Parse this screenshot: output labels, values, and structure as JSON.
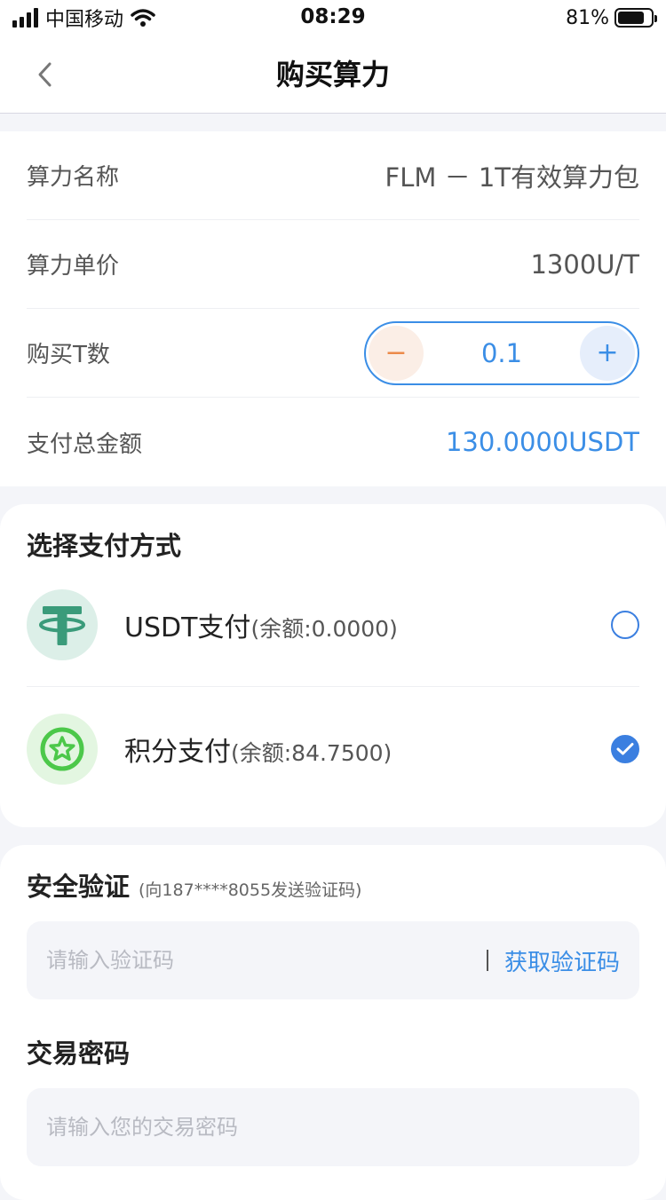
{
  "status_bar": {
    "carrier": "中国移动",
    "time": "08:29",
    "battery_percent": "81%",
    "battery_level": 0.81
  },
  "nav": {
    "title": "购买算力"
  },
  "details": {
    "name_label": "算力名称",
    "name_value": "FLM － 1T有效算力包",
    "price_label": "算力单价",
    "price_value": "1300U/T",
    "qty_label": "购买T数",
    "qty_minus": "−",
    "qty_value": "0.1",
    "qty_plus": "+",
    "total_label": "支付总金额",
    "total_value": "130.0000USDT"
  },
  "payment": {
    "title": "选择支付方式",
    "methods": [
      {
        "name": "USDT支付",
        "balance": "(余额:0.0000)",
        "selected": false,
        "icon": "tether-icon"
      },
      {
        "name": "积分支付",
        "balance": "(余额:84.7500)",
        "selected": true,
        "icon": "star-points-icon"
      }
    ]
  },
  "security": {
    "title": "安全验证",
    "hint": "(向187****8055发送验证码)",
    "code_placeholder": "请输入验证码",
    "get_code_label": "获取验证码",
    "password_title": "交易密码",
    "password_placeholder": "请输入您的交易密码"
  },
  "colors": {
    "accent": "#3b8ee6",
    "minus": "#ec8a4a",
    "tether": "#3a9b7a",
    "points": "#4cc84a"
  }
}
